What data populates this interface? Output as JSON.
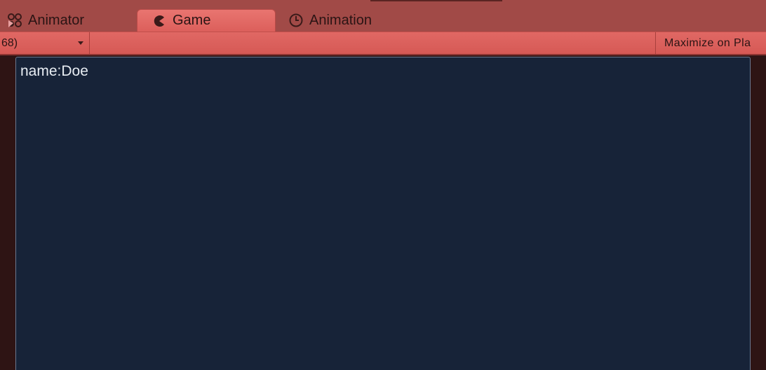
{
  "tabs": [
    {
      "label": "Animator",
      "icon": "animator-icon"
    },
    {
      "label": "Game",
      "icon": "pacman-icon",
      "active": true
    },
    {
      "label": "Animation",
      "icon": "clock-icon"
    }
  ],
  "toolbar": {
    "aspect_value": "68)",
    "maximize_label": "Maximize on Pla"
  },
  "game_view": {
    "text": "name:Doe"
  },
  "colors": {
    "tabbar": "#a14a47",
    "active_tab": "#e06864",
    "toolbar": "#dc5f5b",
    "game_background": "#172338",
    "game_text": "#e8edf3"
  }
}
